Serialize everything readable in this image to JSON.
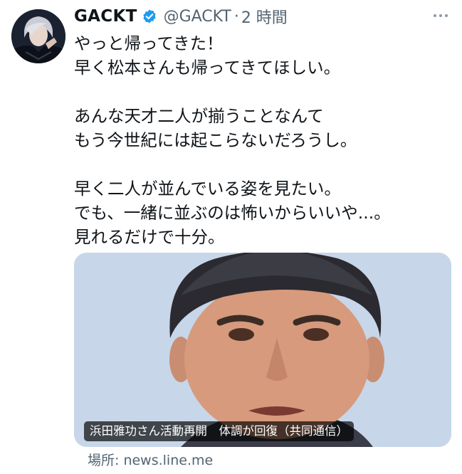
{
  "author": {
    "display_name": "GACKT",
    "handle": "@GACKT",
    "separator": "·",
    "timestamp": "2 時間",
    "verified": true,
    "avatar_icon": "profile-photo"
  },
  "tweet": {
    "lines": [
      "やっと帰ってきた！",
      "早く松本さんも帰ってきてほしい。",
      "",
      "あんな天才二人が揃うことなんて",
      "もう今世紀には起こらないだろうし。",
      "",
      "早く二人が並んでいる姿を見たい。",
      "でも、一緒に並ぶのは怖いからいいや...。",
      "見れるだけで十分。"
    ]
  },
  "link_card": {
    "title": "浜田雅功さん活動再開　体調が回復（共同通信）",
    "source_label": "場所: news.line.me"
  },
  "colors": {
    "verified_badge": "#1d9bf0",
    "secondary_text": "#536471",
    "card_background": "#c7d6e8"
  }
}
